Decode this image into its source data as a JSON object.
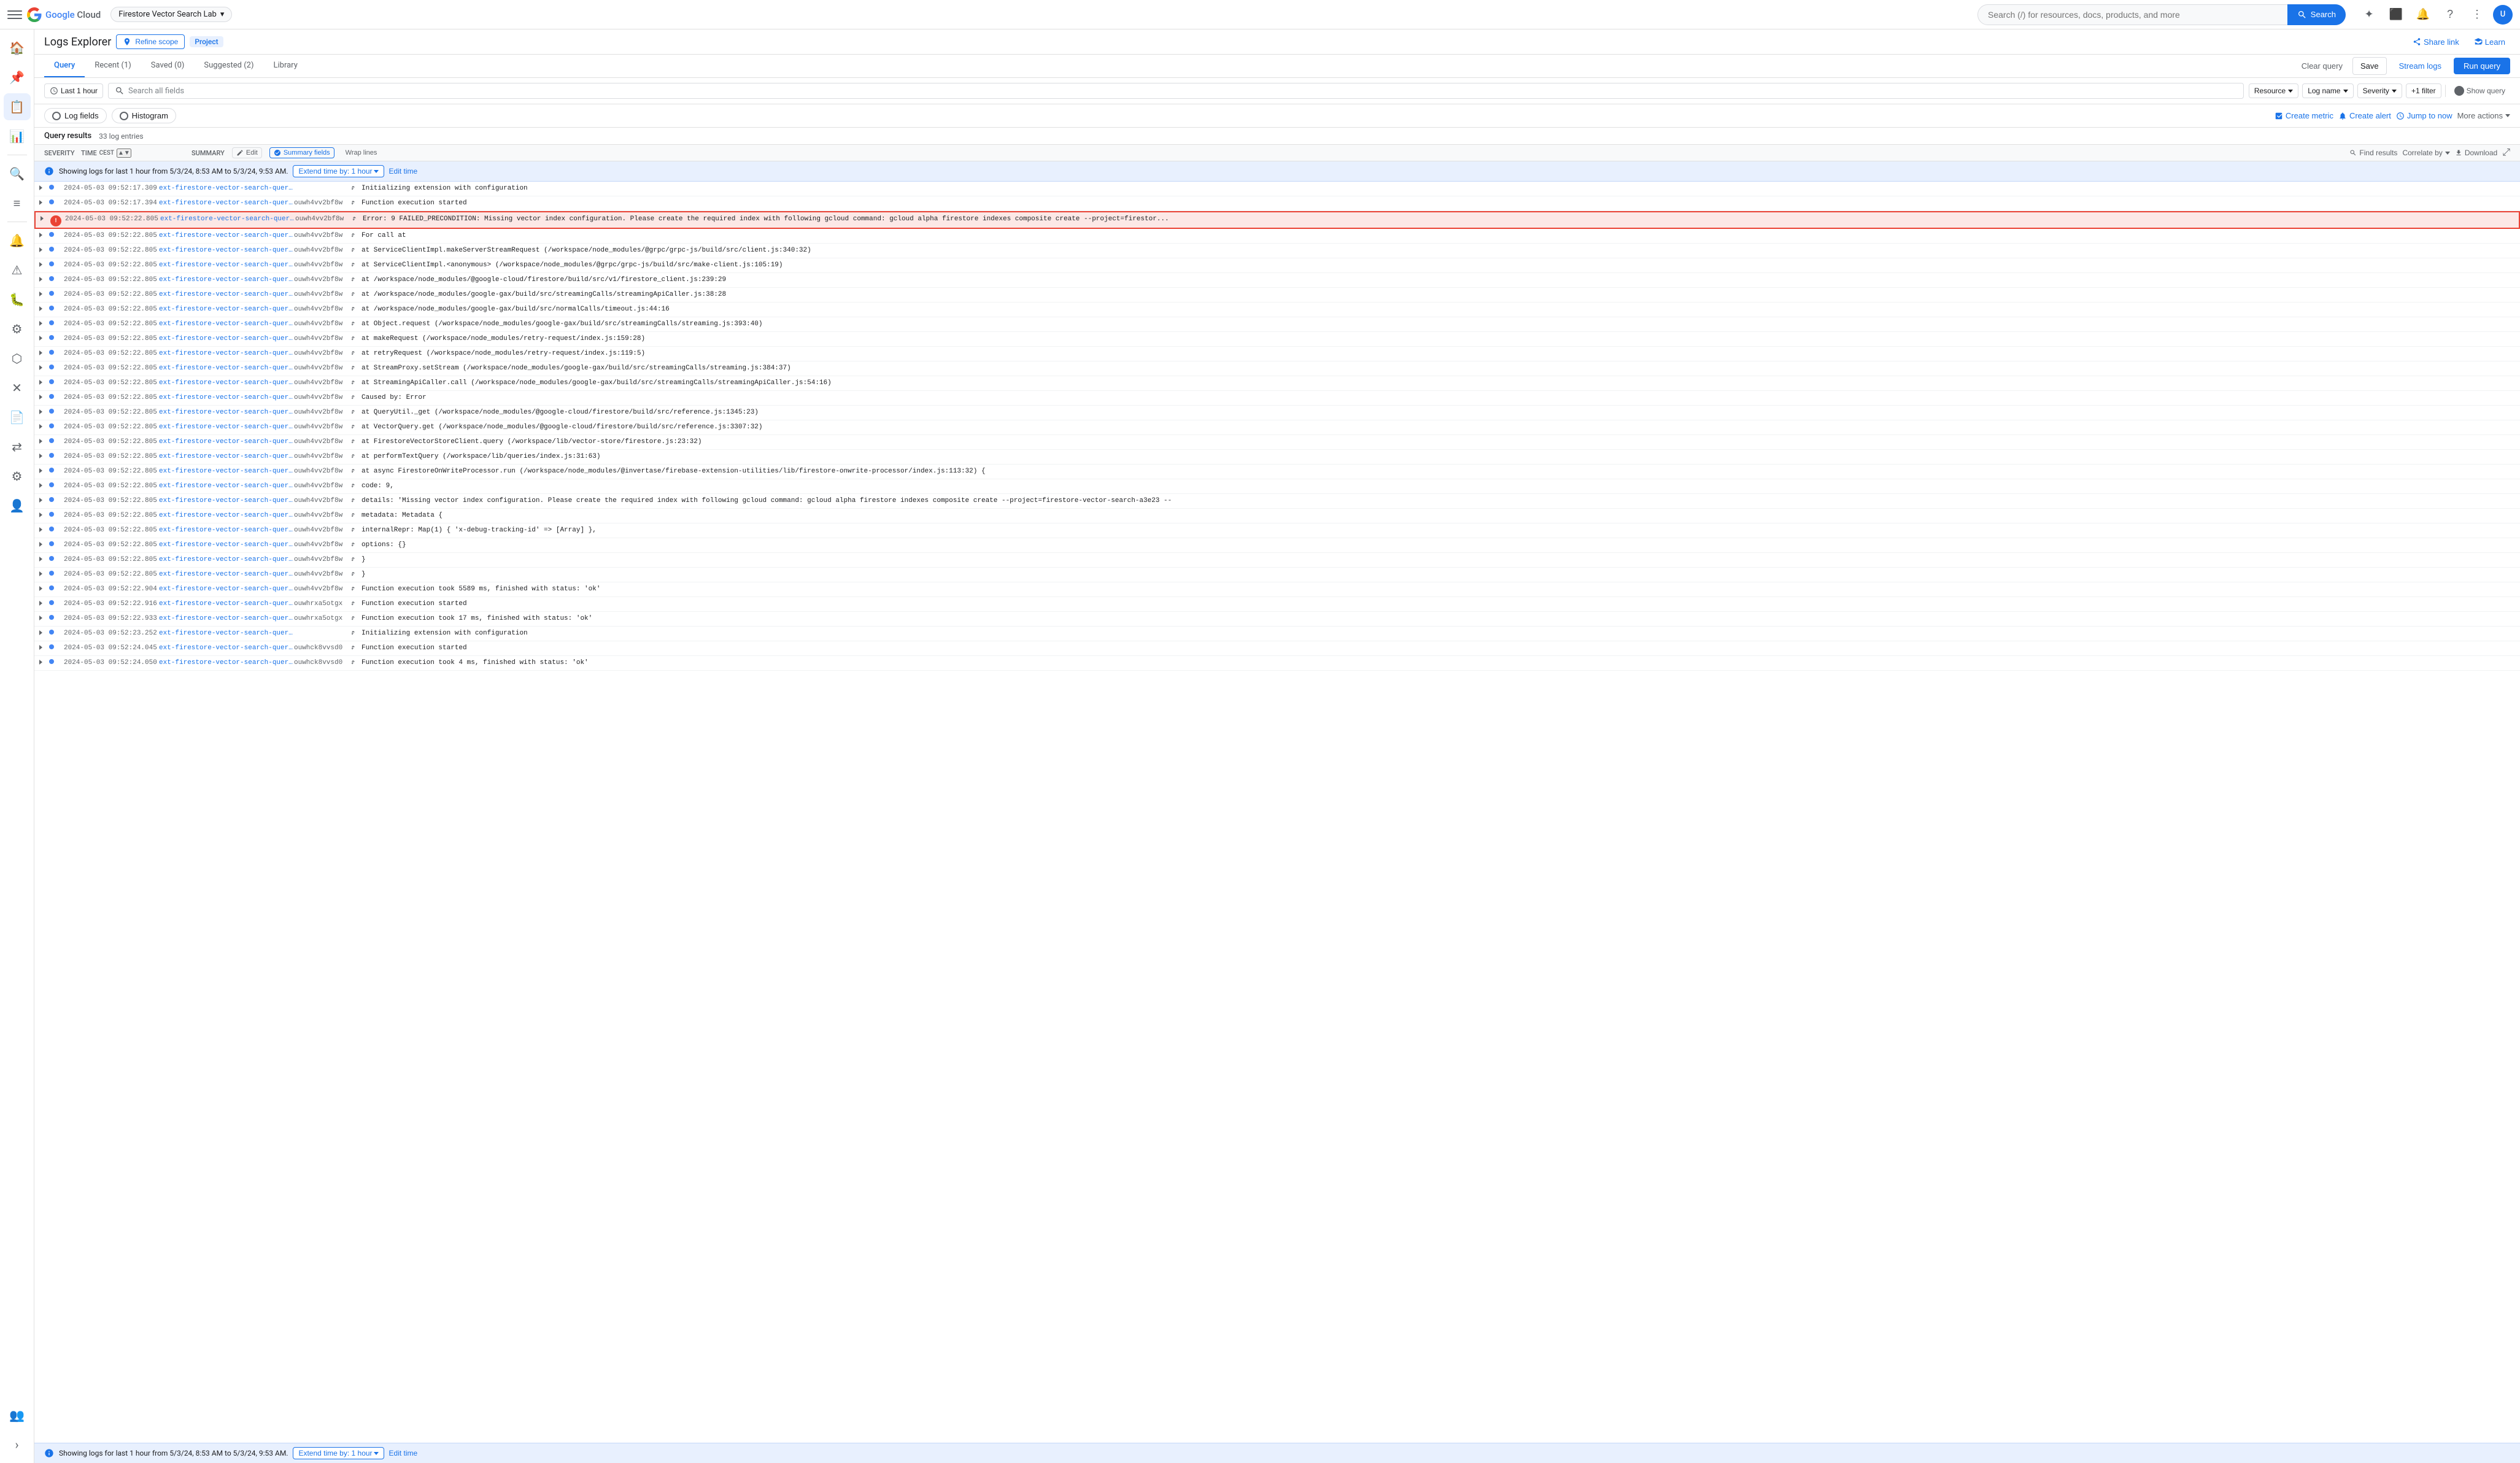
{
  "topNav": {
    "projectName": "Firestore Vector Search Lab",
    "searchPlaceholder": "Search (/) for resources, docs, products, and more",
    "searchBtn": "Search"
  },
  "logsExplorer": {
    "title": "Logs Explorer",
    "refineScope": "Refine scope",
    "projectBadge": "Project",
    "shareLink": "Share link",
    "learn": "Learn"
  },
  "tabs": [
    {
      "label": "Query",
      "active": true
    },
    {
      "label": "Recent (1)",
      "active": false
    },
    {
      "label": "Saved (0)",
      "active": false
    },
    {
      "label": "Suggested (2)",
      "active": false
    },
    {
      "label": "Library",
      "active": false
    }
  ],
  "tabActions": {
    "clearQuery": "Clear query",
    "save": "Save",
    "streamLogs": "Stream logs",
    "runQuery": "Run query"
  },
  "queryBar": {
    "timeFilter": "Last 1 hour",
    "searchPlaceholder": "Search all fields",
    "resource": "Resource",
    "logName": "Log name",
    "severity": "Severity",
    "moreFilters": "+1 filter",
    "showQuery": "Show query"
  },
  "logTools": {
    "logFields": "Log fields",
    "histogram": "Histogram",
    "createMetric": "Create metric",
    "createAlert": "Create alert",
    "jumpToNow": "Jump to now",
    "moreActions": "More actions"
  },
  "resultsHeader": {
    "title": "Query results",
    "count": "33 log entries",
    "colSeverity": "SEVERITY",
    "colTime": "TIME",
    "colTimeZone": "CEST",
    "colSummary": "SUMMARY",
    "edit": "Edit",
    "summaryFields": "Summary fields",
    "wrapLines": "Wrap lines",
    "findResults": "Find results",
    "correlateBy": "Correlate by",
    "download": "Download"
  },
  "infoBanner": {
    "text": "Showing logs for last 1 hour from 5/3/24, 8:53 AM to 5/3/24, 9:53 AM.",
    "extendTime": "Extend time by: 1 hour",
    "editTime": "Edit time"
  },
  "logEntries": [
    {
      "severity": "info",
      "timestamp": "2024-05-03 09:52:17.309",
      "service": "ext-firestore-vector-search-queryOnWrite",
      "instance": "",
      "message": "Initializing extension with configuration",
      "highlighted": false
    },
    {
      "severity": "info",
      "timestamp": "2024-05-03 09:52:17.394",
      "service": "ext-firestore-vector-search-queryOnWrite",
      "instance": "ouwh4vv2bf8w",
      "message": "Function execution started",
      "highlighted": false
    },
    {
      "severity": "error",
      "timestamp": "2024-05-03 09:52:22.805",
      "service": "ext-firestore-vector-search-queryOnWrite",
      "instance": "ouwh4vv2bf8w",
      "message": "Error: 9 FAILED_PRECONDITION: Missing vector index configuration. Please create the required index with following gcloud command: gcloud alpha firestore indexes composite create --project=firestor...",
      "highlighted": true,
      "isMainError": true
    },
    {
      "severity": "info",
      "timestamp": "2024-05-03 09:52:22.805",
      "service": "ext-firestore-vector-search-queryOnWrite",
      "instance": "ouwh4vv2bf8w",
      "message": "    For call at",
      "highlighted": false
    },
    {
      "severity": "info",
      "timestamp": "2024-05-03 09:52:22.805",
      "service": "ext-firestore-vector-search-queryOnWrite",
      "instance": "ouwh4vv2bf8w",
      "message": "    at ServiceClientImpl.makeServerStreamRequest (/workspace/node_modules/@grpc/grpc-js/build/src/client.js:340:32)",
      "highlighted": false
    },
    {
      "severity": "info",
      "timestamp": "2024-05-03 09:52:22.805",
      "service": "ext-firestore-vector-search-queryOnWrite",
      "instance": "ouwh4vv2bf8w",
      "message": "    at ServiceClientImpl.<anonymous> (/workspace/node_modules/@grpc/grpc-js/build/src/make-client.js:105:19)",
      "highlighted": false
    },
    {
      "severity": "info",
      "timestamp": "2024-05-03 09:52:22.805",
      "service": "ext-firestore-vector-search-queryOnWrite",
      "instance": "ouwh4vv2bf8w",
      "message": "    at /workspace/node_modules/@google-cloud/firestore/build/src/v1/firestore_client.js:239:29",
      "highlighted": false
    },
    {
      "severity": "info",
      "timestamp": "2024-05-03 09:52:22.805",
      "service": "ext-firestore-vector-search-queryOnWrite",
      "instance": "ouwh4vv2bf8w",
      "message": "    at /workspace/node_modules/google-gax/build/src/streamingCalls/streamingApiCaller.js:38:28",
      "highlighted": false
    },
    {
      "severity": "info",
      "timestamp": "2024-05-03 09:52:22.805",
      "service": "ext-firestore-vector-search-queryOnWrite",
      "instance": "ouwh4vv2bf8w",
      "message": "    at /workspace/node_modules/google-gax/build/src/normalCalls/timeout.js:44:16",
      "highlighted": false
    },
    {
      "severity": "info",
      "timestamp": "2024-05-03 09:52:22.805",
      "service": "ext-firestore-vector-search-queryOnWrite",
      "instance": "ouwh4vv2bf8w",
      "message": "    at Object.request (/workspace/node_modules/google-gax/build/src/streamingCalls/streaming.js:393:40)",
      "highlighted": false
    },
    {
      "severity": "info",
      "timestamp": "2024-05-03 09:52:22.805",
      "service": "ext-firestore-vector-search-queryOnWrite",
      "instance": "ouwh4vv2bf8w",
      "message": "    at makeRequest (/workspace/node_modules/retry-request/index.js:159:28)",
      "highlighted": false
    },
    {
      "severity": "info",
      "timestamp": "2024-05-03 09:52:22.805",
      "service": "ext-firestore-vector-search-queryOnWrite",
      "instance": "ouwh4vv2bf8w",
      "message": "    at retryRequest (/workspace/node_modules/retry-request/index.js:119:5)",
      "highlighted": false
    },
    {
      "severity": "info",
      "timestamp": "2024-05-03 09:52:22.805",
      "service": "ext-firestore-vector-search-queryOnWrite",
      "instance": "ouwh4vv2bf8w",
      "message": "    at StreamProxy.setStream (/workspace/node_modules/google-gax/build/src/streamingCalls/streaming.js:384:37)",
      "highlighted": false
    },
    {
      "severity": "info",
      "timestamp": "2024-05-03 09:52:22.805",
      "service": "ext-firestore-vector-search-queryOnWrite",
      "instance": "ouwh4vv2bf8w",
      "message": "    at StreamingApiCaller.call (/workspace/node_modules/google-gax/build/src/streamingCalls/streamingApiCaller.js:54:16)",
      "highlighted": false
    },
    {
      "severity": "info",
      "timestamp": "2024-05-03 09:52:22.805",
      "service": "ext-firestore-vector-search-queryOnWrite",
      "instance": "ouwh4vv2bf8w",
      "message": "Caused by: Error",
      "highlighted": false
    },
    {
      "severity": "info",
      "timestamp": "2024-05-03 09:52:22.805",
      "service": "ext-firestore-vector-search-queryOnWrite",
      "instance": "ouwh4vv2bf8w",
      "message": "    at QueryUtil._get (/workspace/node_modules/@google-cloud/firestore/build/src/reference.js:1345:23)",
      "highlighted": false
    },
    {
      "severity": "info",
      "timestamp": "2024-05-03 09:52:22.805",
      "service": "ext-firestore-vector-search-queryOnWrite",
      "instance": "ouwh4vv2bf8w",
      "message": "    at VectorQuery.get (/workspace/node_modules/@google-cloud/firestore/build/src/reference.js:3307:32)",
      "highlighted": false
    },
    {
      "severity": "info",
      "timestamp": "2024-05-03 09:52:22.805",
      "service": "ext-firestore-vector-search-queryOnWrite",
      "instance": "ouwh4vv2bf8w",
      "message": "    at FirestoreVectorStoreClient.query (/workspace/lib/vector-store/firestore.js:23:32)",
      "highlighted": false
    },
    {
      "severity": "info",
      "timestamp": "2024-05-03 09:52:22.805",
      "service": "ext-firestore-vector-search-queryOnWrite",
      "instance": "ouwh4vv2bf8w",
      "message": "    at performTextQuery (/workspace/lib/queries/index.js:31:63)",
      "highlighted": false
    },
    {
      "severity": "info",
      "timestamp": "2024-05-03 09:52:22.805",
      "service": "ext-firestore-vector-search-queryOnWrite",
      "instance": "ouwh4vv2bf8w",
      "message": "    at async FirestoreOnWriteProcessor.run (/workspace/node_modules/@invertase/firebase-extension-utilities/lib/firestore-onwrite-processor/index.js:113:32) {",
      "highlighted": false
    },
    {
      "severity": "info",
      "timestamp": "2024-05-03 09:52:22.805",
      "service": "ext-firestore-vector-search-queryOnWrite",
      "instance": "ouwh4vv2bf8w",
      "message": "  code: 9,",
      "highlighted": false
    },
    {
      "severity": "info",
      "timestamp": "2024-05-03 09:52:22.805",
      "service": "ext-firestore-vector-search-queryOnWrite",
      "instance": "ouwh4vv2bf8w",
      "message": "  details: 'Missing vector index configuration. Please create the required index with following gcloud command: gcloud alpha firestore indexes composite create --project=firestore-vector-search-a3e23 --",
      "highlighted": false
    },
    {
      "severity": "info",
      "timestamp": "2024-05-03 09:52:22.805",
      "service": "ext-firestore-vector-search-queryOnWrite",
      "instance": "ouwh4vv2bf8w",
      "message": "  metadata: Metadata {",
      "highlighted": false
    },
    {
      "severity": "info",
      "timestamp": "2024-05-03 09:52:22.805",
      "service": "ext-firestore-vector-search-queryOnWrite",
      "instance": "ouwh4vv2bf8w",
      "message": "    internalRepr: Map(1) { 'x-debug-tracking-id' => [Array] },",
      "highlighted": false
    },
    {
      "severity": "info",
      "timestamp": "2024-05-03 09:52:22.805",
      "service": "ext-firestore-vector-search-queryOnWrite",
      "instance": "ouwh4vv2bf8w",
      "message": "    options: {}",
      "highlighted": false
    },
    {
      "severity": "info",
      "timestamp": "2024-05-03 09:52:22.805",
      "service": "ext-firestore-vector-search-queryOnWrite",
      "instance": "ouwh4vv2bf8w",
      "message": "  }",
      "highlighted": false
    },
    {
      "severity": "info",
      "timestamp": "2024-05-03 09:52:22.805",
      "service": "ext-firestore-vector-search-queryOnWrite",
      "instance": "ouwh4vv2bf8w",
      "message": "}",
      "highlighted": false
    },
    {
      "severity": "info",
      "timestamp": "2024-05-03 09:52:22.904",
      "service": "ext-firestore-vector-search-queryOnWrite",
      "instance": "ouwh4vv2bf8w",
      "message": "Function execution took 5589 ms, finished with status: 'ok'",
      "highlighted": false
    },
    {
      "severity": "info",
      "timestamp": "2024-05-03 09:52:22.916",
      "service": "ext-firestore-vector-search-queryOnWrite",
      "instance": "ouwhrxa5otgx",
      "message": "Function execution started",
      "highlighted": false
    },
    {
      "severity": "info",
      "timestamp": "2024-05-03 09:52:22.933",
      "service": "ext-firestore-vector-search-queryOnWrite",
      "instance": "ouwhrxa5otgx",
      "message": "Function execution took 17 ms, finished with status: 'ok'",
      "highlighted": false
    },
    {
      "severity": "info",
      "timestamp": "2024-05-03 09:52:23.252",
      "service": "ext-firestore-vector-search-queryOnWrite",
      "instance": "",
      "message": "Initializing extension with configuration",
      "highlighted": false
    },
    {
      "severity": "info",
      "timestamp": "2024-05-03 09:52:24.045",
      "service": "ext-firestore-vector-search-queryOnWrite",
      "instance": "ouwhck8vvsd0",
      "message": "Function execution started",
      "highlighted": false
    },
    {
      "severity": "info",
      "timestamp": "2024-05-03 09:52:24.050",
      "service": "ext-firestore-vector-search-queryOnWrite",
      "instance": "ouwhck8vvsd0",
      "message": "Function execution took 4 ms, finished with status: 'ok'",
      "highlighted": false
    }
  ],
  "bottomBanner": {
    "text": "Showing logs for last 1 hour from 5/3/24, 8:53 AM to 5/3/24, 9:53 AM.",
    "extendTime": "Extend time by: 1 hour",
    "editTime": "Edit time"
  }
}
